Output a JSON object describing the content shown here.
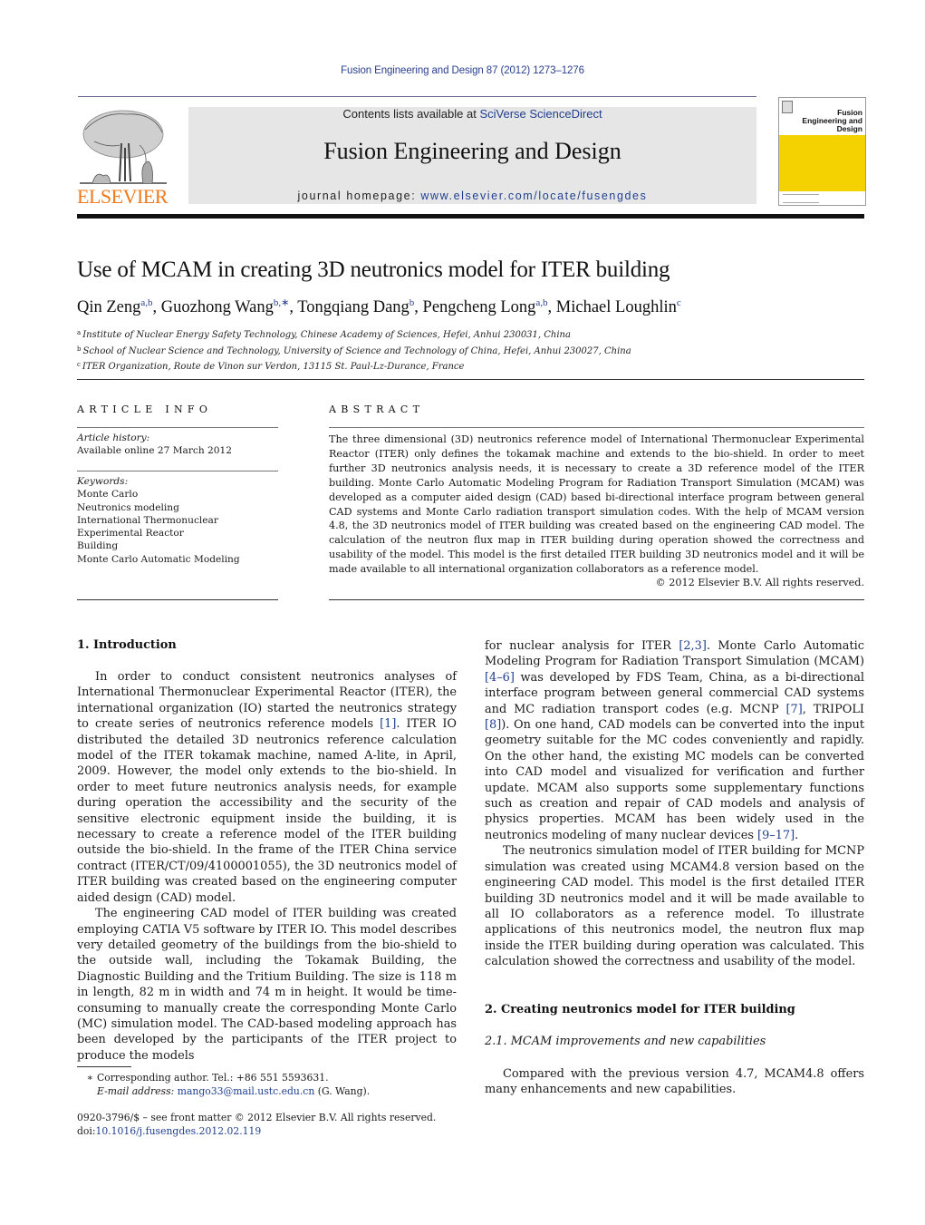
{
  "header": {
    "journal_reference": "Fusion Engineering and Design 87 (2012) 1273–1276",
    "publisher_logo_text": "ELSEVIER",
    "contents_prefix": "Contents lists available at ",
    "contents_link": "SciVerse ScienceDirect",
    "journal_title": "Fusion Engineering and Design",
    "homepage_prefix": "journal homepage: ",
    "homepage_link": "www.elsevier.com/locate/fusengdes",
    "cover_title": "Fusion Engineering and Design",
    "colors": {
      "logo_orange": "#f07a1b",
      "cover_yellow": "#f4d100",
      "link_blue": "#1f3f8f",
      "banner_grey": "#e6e6e6"
    }
  },
  "article": {
    "title": "Use of MCAM in creating 3D neutronics model for ITER building",
    "authors": [
      {
        "name": "Qin Zeng",
        "sup": "a,b",
        "sep": ", "
      },
      {
        "name": "Guozhong Wang",
        "sup": "b,∗",
        "sep": ", "
      },
      {
        "name": "Tongqiang Dang",
        "sup": "b",
        "sep": ", "
      },
      {
        "name": "Pengcheng Long",
        "sup": "a,b",
        "sep": ", "
      },
      {
        "name": "Michael Loughlin",
        "sup": "c",
        "sep": ""
      }
    ],
    "affiliations": [
      {
        "mark": "a",
        "text": "Institute of Nuclear Energy Safety Technology, Chinese Academy of Sciences, Hefei, Anhui 230031, China"
      },
      {
        "mark": "b",
        "text": "School of Nuclear Science and Technology, University of Science and Technology of China, Hefei, Anhui 230027, China"
      },
      {
        "mark": "c",
        "text": "ITER Organization, Route de Vinon sur Verdon, 13115 St. Paul-Lz-Durance, France"
      }
    ]
  },
  "article_info": {
    "heading": "ARTICLE INFO",
    "history_label": "Article history:",
    "history_value": "Available online 27 March 2012",
    "keywords_label": "Keywords:",
    "keywords": [
      "Monte Carlo",
      "Neutronics modeling",
      "International Thermonuclear Experimental Reactor",
      "Building",
      "Monte Carlo Automatic Modeling"
    ]
  },
  "abstract": {
    "heading": "ABSTRACT",
    "text": "The three dimensional (3D) neutronics reference model of International Thermonuclear Experimental Reactor (ITER) only defines the tokamak machine and extends to the bio-shield. In order to meet further 3D neutronics analysis needs, it is necessary to create a 3D reference model of the ITER building. Monte Carlo Automatic Modeling Program for Radiation Transport Simulation (MCAM) was developed as a computer aided design (CAD) based bi-directional interface program between general CAD systems and Monte Carlo radiation transport simulation codes. With the help of MCAM version 4.8, the 3D neutronics model of ITER building was created based on the engineering CAD model. The calculation of the neutron flux map in ITER building during operation showed the correctness and usability of the model. This model is the first detailed ITER building 3D neutronics model and it will be made available to all international organization collaborators as a reference model.",
    "copyright": "© 2012 Elsevier B.V. All rights reserved."
  },
  "body": {
    "section1_heading": "1.  Introduction",
    "left_paragraphs": [
      [
        {
          "t": "In order to conduct consistent neutronics analyses of International Thermonuclear Experimental Reactor (ITER), the international organization (IO) started the neutronics strategy to create series of neutronics reference models "
        },
        {
          "t": "[1]",
          "ref": true
        },
        {
          "t": ". ITER IO distributed the detailed 3D neutronics reference calculation model of the ITER tokamak machine, named A-lite, in April, 2009. However, the model only extends to the bio-shield. In order to meet future neutronics analysis needs, for example during operation the accessibility and the security of the sensitive electronic equipment inside the building, it is necessary to create a reference model of the ITER building outside the bio-shield. In the frame of the ITER China service contract (ITER/CT/09/4100001055), the 3D neutronics model of ITER building was created based on the engineering computer aided design (CAD) model."
        }
      ],
      [
        {
          "t": "The engineering CAD model of ITER building was created employing CATIA V5 software by ITER IO. This model describes very detailed geometry of the buildings from the bio-shield to the outside wall, including the Tokamak Building, the Diagnostic Building and the Tritium Building. The size is 118 m in length, 82 m in width and 74 m in height. It would be time-consuming to manually create the corresponding Monte Carlo (MC) simulation model. The CAD-based modeling approach has been developed by the participants of the ITER project to produce the models"
        }
      ]
    ],
    "right_paragraphs": [
      [
        {
          "t": "for nuclear analysis for ITER "
        },
        {
          "t": "[2,3]",
          "ref": true
        },
        {
          "t": ". Monte Carlo Automatic Modeling Program for Radiation Transport Simulation (MCAM) "
        },
        {
          "t": "[4–6]",
          "ref": true
        },
        {
          "t": " was developed by FDS Team, China, as a bi-directional interface program between general commercial CAD systems and MC radiation transport codes (e.g. MCNP "
        },
        {
          "t": "[7]",
          "ref": true
        },
        {
          "t": ", TRIPOLI "
        },
        {
          "t": "[8]",
          "ref": true
        },
        {
          "t": "). On one hand, CAD models can be converted into the input geometry suitable for the MC codes conveniently and rapidly. On the other hand, the existing MC models can be converted into CAD model and visualized for verification and further update. MCAM also supports some supplementary functions such as creation and repair of CAD models and analysis of physics properties. MCAM has been widely used in the neutronics modeling of many nuclear devices "
        },
        {
          "t": "[9–17]",
          "ref": true
        },
        {
          "t": "."
        }
      ],
      [
        {
          "t": "The neutronics simulation model of ITER building for MCNP simulation was created using MCAM4.8 version based on the engineering CAD model. This model is the first detailed ITER building 3D neutronics model and it will be made available to all IO collaborators as a reference model. To illustrate applications of this neutronics model, the neutron flux map inside the ITER building during operation was calculated. This calculation showed the correctness and usability of the model."
        }
      ]
    ],
    "section2_heading": "2.  Creating neutronics model for ITER building",
    "subsection21_heading": "2.1.  MCAM improvements and new capabilities",
    "section2_paragraph": "Compared with the previous version 4.7, MCAM4.8 offers many enhancements and new capabilities."
  },
  "footnote": {
    "star": "∗",
    "corresponding": "Corresponding author. Tel.: +86 551 5593631.",
    "email_label": "E-mail address:",
    "email": "mango33@mail.ustc.edu.cn",
    "email_suffix": " (G. Wang)."
  },
  "front_matter": {
    "issn_line": "0920-3796/$ – see front matter © 2012 Elsevier B.V. All rights reserved.",
    "doi_prefix": "doi:",
    "doi": "10.1016/j.fusengdes.2012.02.119"
  }
}
